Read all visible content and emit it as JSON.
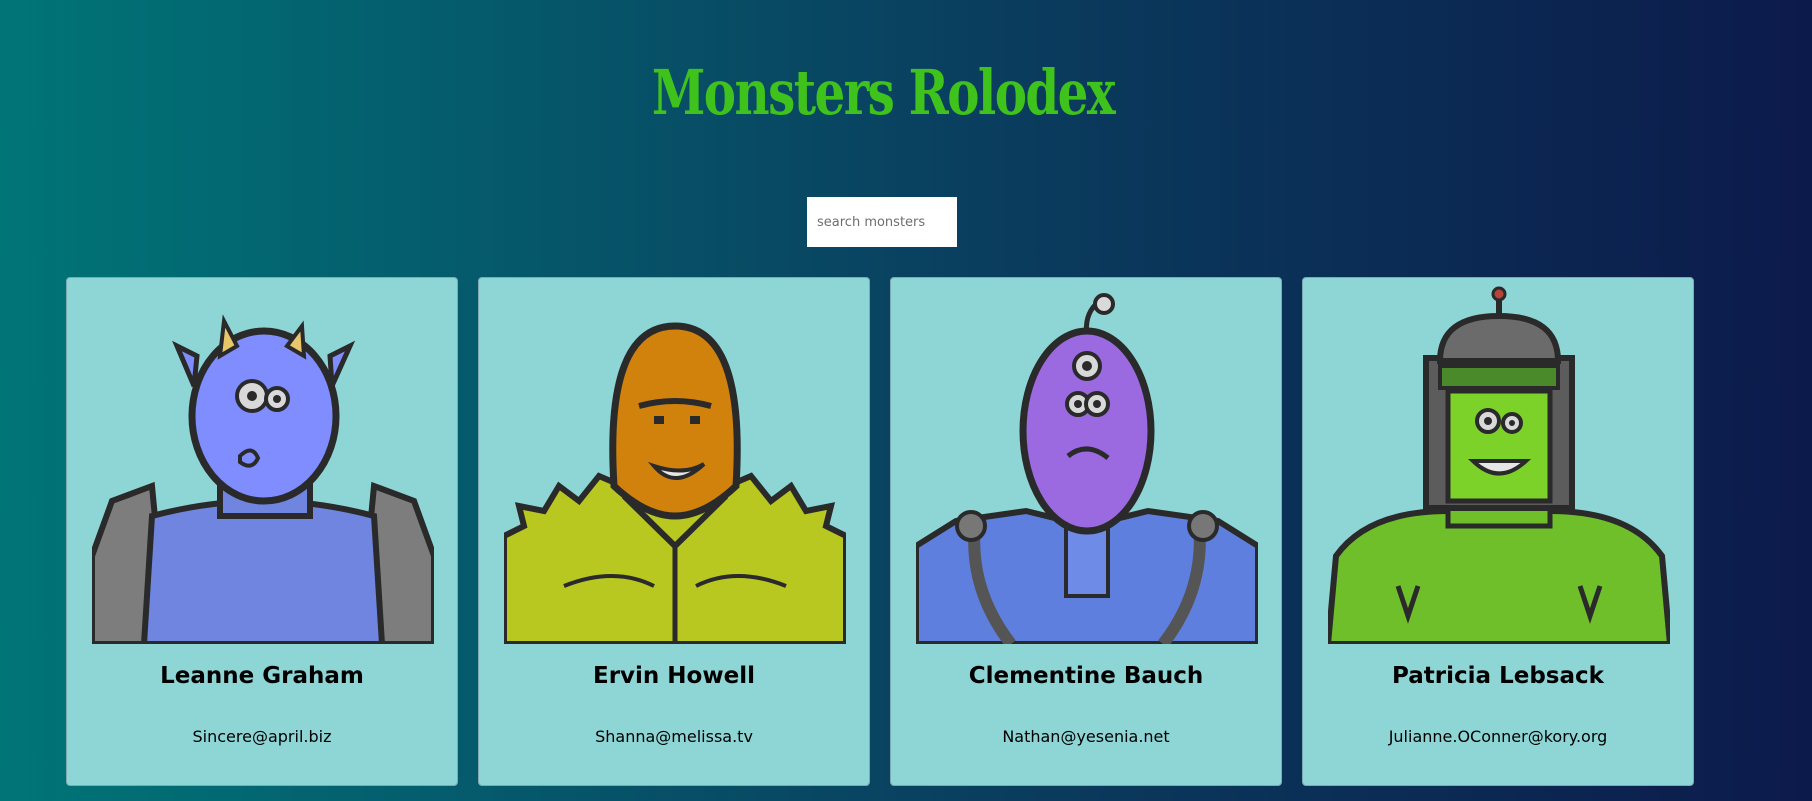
{
  "app": {
    "title": "Monsters Rolodex"
  },
  "search": {
    "placeholder": "search monsters",
    "value": ""
  },
  "monsters": [
    {
      "name": "Leanne Graham",
      "email": "Sincere@april.biz",
      "avatar": "blue-horned-monster-icon"
    },
    {
      "name": "Ervin Howell",
      "email": "Shanna@melissa.tv",
      "avatar": "orange-spiky-monster-icon"
    },
    {
      "name": "Clementine Bauch",
      "email": "Nathan@yesenia.net",
      "avatar": "purple-cyclops-robot-monster-icon"
    },
    {
      "name": "Patricia Lebsack",
      "email": "Julianne.OConner@kory.org",
      "avatar": "green-helmet-robot-monster-icon"
    }
  ],
  "colors": {
    "title": "#3fc21c",
    "card_bg": "#8ed5d6",
    "bg_left": "#007577",
    "bg_right": "#0c1a4b"
  }
}
